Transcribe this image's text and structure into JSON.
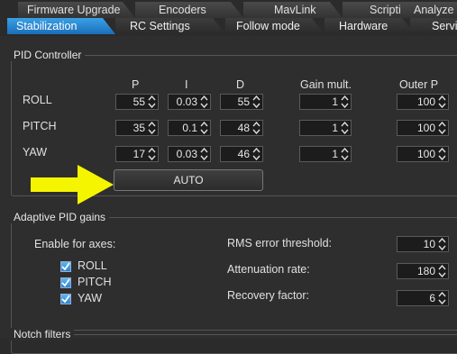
{
  "tabs_back": [
    "Firmware Upgrade",
    "Encoders",
    "MavLink",
    "Scripting",
    "Analyze"
  ],
  "tabs_front": [
    "Stabilization",
    "RC Settings",
    "Follow mode",
    "Hardware",
    "Servi"
  ],
  "active_tab": "Stabilization",
  "pid": {
    "title": "PID Controller",
    "columns": {
      "p": "P",
      "i": "I",
      "d": "D",
      "gain": "Gain mult.",
      "outer_p": "Outer P"
    },
    "rows": [
      {
        "axis": "ROLL",
        "p": "55",
        "i": "0.03",
        "d": "55",
        "gain": "1",
        "outer_p": "100"
      },
      {
        "axis": "PITCH",
        "p": "35",
        "i": "0.1",
        "d": "48",
        "gain": "1",
        "outer_p": "100"
      },
      {
        "axis": "YAW",
        "p": "17",
        "i": "0.03",
        "d": "46",
        "gain": "1",
        "outer_p": "100"
      }
    ],
    "auto_button": "AUTO"
  },
  "adaptive": {
    "title": "Adaptive PID gains",
    "enable_label": "Enable for axes:",
    "axes": [
      "ROLL",
      "PITCH",
      "YAW"
    ],
    "rms_label": "RMS error threshold:",
    "rms_value": "10",
    "attenuation_label": "Attenuation rate:",
    "attenuation_value": "180",
    "recovery_label": "Recovery factor:",
    "recovery_value": "6"
  },
  "notch": {
    "title": "Notch filters"
  },
  "colors": {
    "active_tab": "#1f7fd0",
    "arrow": "#f5f500",
    "checkbox": "#3a9be0"
  }
}
